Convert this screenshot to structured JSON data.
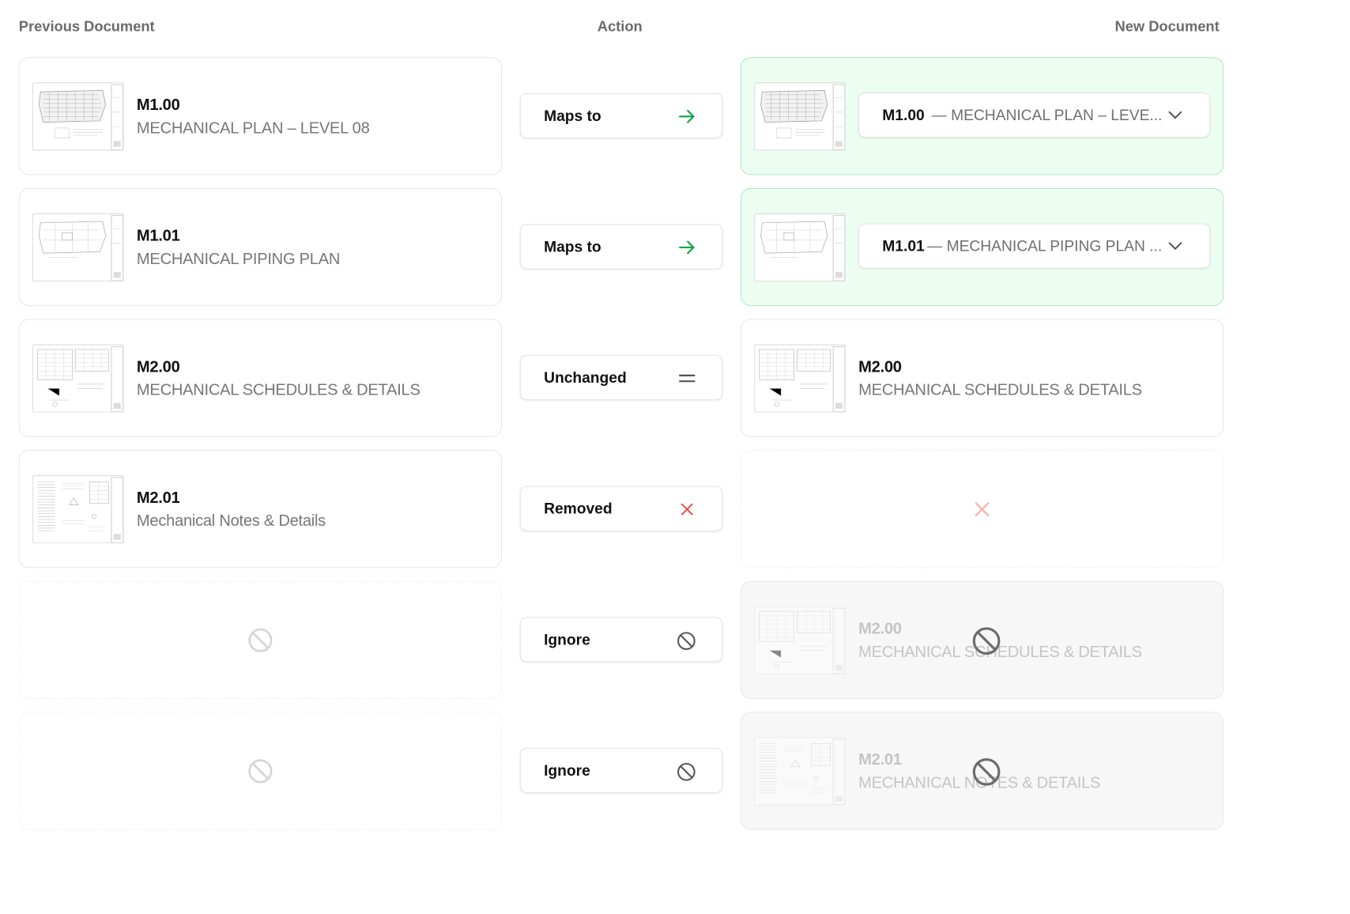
{
  "headers": {
    "previous": "Previous Document",
    "action": "Action",
    "new": "New Document"
  },
  "rows": [
    {
      "prev": {
        "code": "M1.00",
        "title": "MECHANICAL PLAN – LEVEL 08"
      },
      "action": {
        "label": "Maps to",
        "icon": "arrow-right-icon",
        "color": "#16a34a"
      },
      "new": {
        "select_code": "M1.00",
        "select_title": "— MECHANICAL PLAN – LEVE...",
        "icon": "chevron-down-icon"
      }
    },
    {
      "prev": {
        "code": "M1.01",
        "title": "MECHANICAL PIPING PLAN"
      },
      "action": {
        "label": "Maps to",
        "icon": "arrow-right-icon",
        "color": "#16a34a"
      },
      "new": {
        "select_code": "M1.01",
        "select_title": "— MECHANICAL PIPING PLAN ...",
        "icon": "chevron-down-icon"
      }
    },
    {
      "prev": {
        "code": "M2.00",
        "title": "MECHANICAL SCHEDULES & DETAILS"
      },
      "action": {
        "label": "Unchanged",
        "icon": "equals-icon",
        "color": "#555555"
      },
      "new": {
        "code": "M2.00",
        "title": "MECHANICAL SCHEDULES & DETAILS"
      }
    },
    {
      "prev": {
        "code": "M2.01",
        "title": "Mechanical Notes & Details"
      },
      "action": {
        "label": "Removed",
        "icon": "x-icon",
        "color": "#ef4444"
      },
      "new": {
        "icon": "x-icon",
        "color": "#f7b4b4"
      }
    },
    {
      "prev": {
        "icon": "ban-icon"
      },
      "action": {
        "label": "Ignore",
        "icon": "ban-icon",
        "color": "#555555"
      },
      "new": {
        "code": "M2.00",
        "title": "MECHANICAL SCHEDULES & DETAILS",
        "icon": "ban-icon"
      }
    },
    {
      "prev": {
        "icon": "ban-icon"
      },
      "action": {
        "label": "Ignore",
        "icon": "ban-icon",
        "color": "#555555"
      },
      "new": {
        "code": "M2.01",
        "title": "MECHANICAL NOTES & DETAILS",
        "icon": "ban-icon"
      }
    }
  ],
  "colors": {
    "mapped_bg": "#ecfdf1",
    "mapped_border": "#a7e8bd",
    "accent_green": "#16a34a",
    "removed_red": "#ef4444"
  }
}
